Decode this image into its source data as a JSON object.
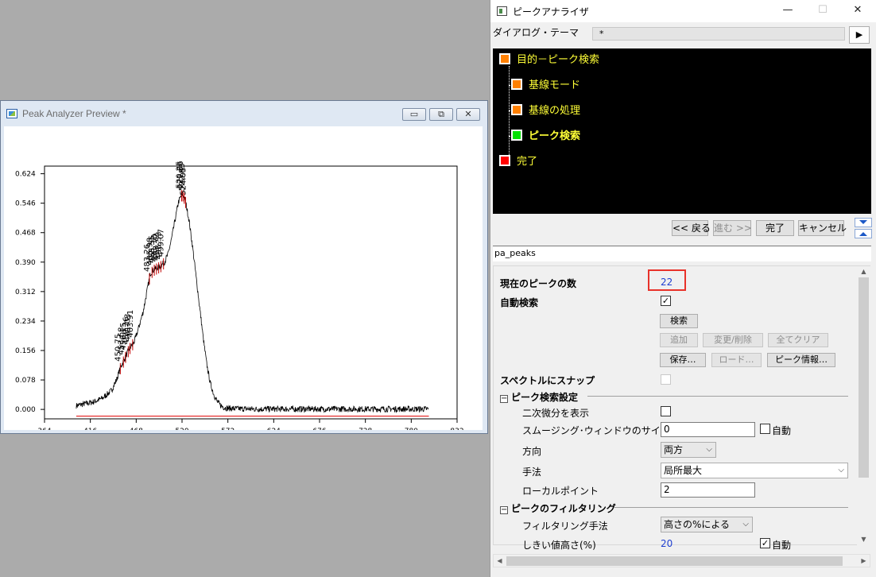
{
  "preview": {
    "title": "Peak Analyzer Preview *",
    "buttons": {
      "minimize": "▭",
      "restore": "⧉",
      "close": "✕"
    }
  },
  "chart_data": {
    "type": "line",
    "title": "",
    "xlabel": "",
    "ylabel": "",
    "xlim": [
      364,
      832
    ],
    "ylim": [
      -0.025,
      0.64
    ],
    "xticks": [
      364,
      416,
      468,
      520,
      572,
      624,
      676,
      728,
      780,
      832
    ],
    "yticks": [
      "0.000",
      "0.078",
      "0.156",
      "0.234",
      "0.312",
      "0.390",
      "0.468",
      "0.546",
      "0.624"
    ],
    "series": [
      {
        "color": "#000000",
        "x": [
          400,
          410,
          420,
          430,
          440,
          446,
          450,
          456,
          460,
          466,
          470,
          476,
          480,
          484,
          488,
          492,
          496,
          500,
          504,
          508,
          512,
          516,
          520,
          522,
          524,
          528,
          532,
          536,
          540,
          544,
          548,
          552,
          556,
          560,
          564,
          568,
          572,
          580,
          600,
          650,
          700,
          750,
          800
        ],
        "y": [
          0.01,
          0.015,
          0.02,
          0.03,
          0.05,
          0.08,
          0.11,
          0.14,
          0.16,
          0.18,
          0.21,
          0.26,
          0.31,
          0.36,
          0.37,
          0.375,
          0.38,
          0.39,
          0.41,
          0.45,
          0.5,
          0.55,
          0.57,
          0.565,
          0.55,
          0.5,
          0.43,
          0.35,
          0.27,
          0.19,
          0.12,
          0.07,
          0.04,
          0.02,
          0.01,
          0.005,
          0.003,
          0.002,
          0.001,
          0.001,
          0.001,
          0.001,
          0.001
        ]
      }
    ],
    "baseline": {
      "color": "#e00000",
      "y": -0.018
    },
    "peak_labels": [
      {
        "text": "450.75",
        "x": 450
      },
      {
        "text": "453.68",
        "x": 453.5
      },
      {
        "text": "456.15",
        "x": 456
      },
      {
        "text": "459.26",
        "x": 459
      },
      {
        "text": "461.03",
        "x": 461
      },
      {
        "text": "463.91",
        "x": 464
      },
      {
        "text": "483.26",
        "x": 483
      },
      {
        "text": "485.98",
        "x": 486
      },
      {
        "text": "488.55",
        "x": 488.5
      },
      {
        "text": "491.10",
        "x": 491
      },
      {
        "text": "493.72",
        "x": 493.5
      },
      {
        "text": "496.33",
        "x": 496
      },
      {
        "text": "499.07",
        "x": 499
      },
      {
        "text": "520.25",
        "x": 519.5
      },
      {
        "text": "521.56",
        "x": 521
      },
      {
        "text": "522.83",
        "x": 522.5
      },
      {
        "text": "524.05",
        "x": 524
      }
    ]
  },
  "panel": {
    "title": "ピークアナライザ",
    "controls": {
      "minimize": "—",
      "maximize": "☐",
      "close": "✕"
    },
    "theme_label": "ダイアログ・テーマ",
    "theme_value": "*",
    "theme_arrow": "▶",
    "wizard": [
      {
        "label": "目的－ピーク検索",
        "color": "#ff8000"
      },
      {
        "label": "基線モード",
        "color": "#ff8000"
      },
      {
        "label": "基線の処理",
        "color": "#ff8000"
      },
      {
        "label": "ピーク検索",
        "color": "#00e000"
      },
      {
        "label": "完了",
        "color": "#ff0000"
      }
    ],
    "nav": {
      "back": "<< 戻る",
      "next": "進む >>",
      "finish": "完了",
      "cancel": "キャンセル"
    },
    "section": "pa_peaks",
    "props": {
      "peak_count_label": "現在のピークの数",
      "peak_count": "22",
      "auto_find_label": "自動検索",
      "btn_find": "検索",
      "btn_add": "追加",
      "btn_modify": "変更/削除",
      "btn_clear": "全てクリア",
      "btn_save": "保存…",
      "btn_load": "ロード…",
      "btn_info": "ピーク情報…",
      "snap_label": "スペクトルにスナップ",
      "group1": "ピーク検索設定",
      "show_2nd_label": "二次微分を表示",
      "smooth_label": "スムージング･ウィンドウのサイズ",
      "smooth_value": "0",
      "auto_label": "自動",
      "direction_label": "方向",
      "direction_value": "両方",
      "method_label": "手法",
      "method_value": "局所最大",
      "local_points_label": "ローカルポイント",
      "local_points_value": "2",
      "group2": "ピークのフィルタリング",
      "filter_method_label": "フィルタリング手法",
      "filter_method_value": "高さの%による",
      "threshold_label": "しきい値高さ(%)",
      "threshold_value": "20",
      "auto2_label": "自動"
    }
  }
}
